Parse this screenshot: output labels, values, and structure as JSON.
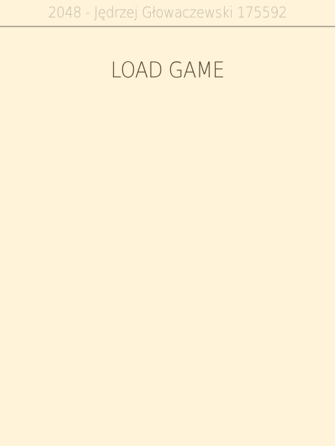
{
  "window": {
    "title": "2048 - Jędrzej Głowaczewski 175592"
  },
  "screen": {
    "heading": "LOAD GAME"
  },
  "colors": {
    "background": "#fff3d9",
    "title_text": "#c3bba8",
    "title_divider": "#b2ab97",
    "heading_text": "#5a4e38"
  }
}
